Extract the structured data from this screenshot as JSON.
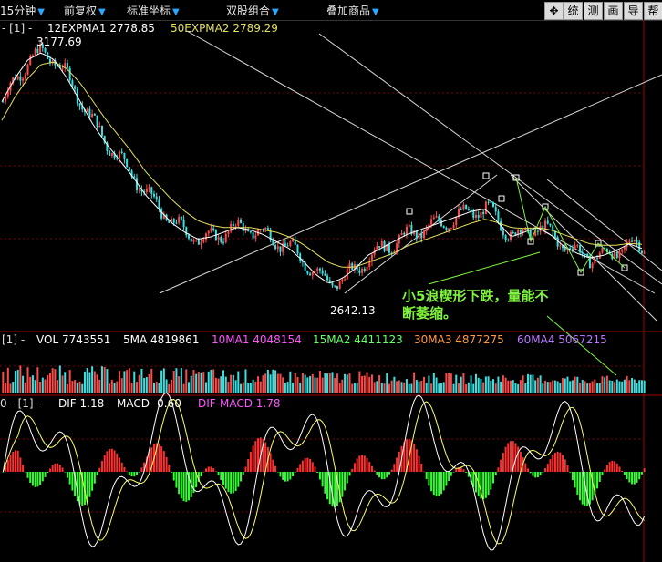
{
  "toolbar": {
    "period": "15分钟",
    "adjust": "前复权",
    "coord": "标准坐标",
    "dual": "双股组合",
    "overlay": "叠加商品",
    "buttons": [
      "统",
      "测",
      "画",
      "导",
      "帮"
    ]
  },
  "panels": {
    "price": {
      "marker": "- [1] -",
      "ema1": "12EXPMA1 2778.85",
      "ema2": "50EXPMA2 2789.29",
      "high_label": "3177.69",
      "low_label": "2642.13"
    },
    "volume": {
      "marker": "[1] -",
      "vol": "VOL 7743551",
      "ma": [
        "5MA 4819861",
        "10MA1 4048154",
        "15MA2 4411123",
        "30MA3 4877275",
        "60MA4 5067215"
      ]
    },
    "macd": {
      "marker": "0 - [1] -",
      "dif": "DIF 1.18",
      "macd": "MACD -0.60",
      "difmacd": "DIF-MACD 1.78"
    }
  },
  "annotation": {
    "line1": "小5浪楔形下跌，量能不",
    "line2": "断萎缩。"
  },
  "colors": {
    "up": "#ff4a4a",
    "down": "#3ce0e0",
    "ema1": "#ffffff",
    "ema2": "#e6e05a",
    "grid": "#7a0000",
    "ma5": "#ffffff",
    "ma10": "#ff55ff",
    "ma15": "#66ff66",
    "ma30": "#ff9944",
    "ma60": "#bb77ff",
    "macd_pos": "#ff3030",
    "macd_neg": "#33ff33",
    "dif": "#ffffff",
    "dea": "#ffff66",
    "annotation": "#7ef53c",
    "trend": "#d8d8d8"
  },
  "chart_data": {
    "type": "line",
    "title": "",
    "xlabel": "",
    "ylabel": "",
    "ylim": [
      2600,
      3200
    ],
    "series": [
      {
        "name": "12EXPMA1",
        "values": [
          3060,
          3110,
          3150,
          3165,
          3150,
          3110,
          3060,
          3010,
          2970,
          2935,
          2900,
          2860,
          2830,
          2800,
          2780,
          2765,
          2770,
          2780,
          2790,
          2785,
          2775,
          2760,
          2745,
          2720,
          2690,
          2670,
          2680,
          2700,
          2730,
          2745,
          2760,
          2775,
          2785,
          2795,
          2805,
          2815,
          2825,
          2830,
          2800,
          2770,
          2780,
          2790,
          2775,
          2750,
          2735,
          2725,
          2730,
          2740,
          2755,
          2745
        ]
      },
      {
        "name": "50EXPMA2",
        "values": [
          3020,
          3070,
          3110,
          3140,
          3145,
          3130,
          3100,
          3060,
          3020,
          2985,
          2950,
          2910,
          2880,
          2850,
          2825,
          2805,
          2795,
          2790,
          2790,
          2790,
          2785,
          2780,
          2770,
          2755,
          2735,
          2715,
          2705,
          2705,
          2715,
          2725,
          2735,
          2750,
          2760,
          2770,
          2780,
          2790,
          2800,
          2808,
          2800,
          2790,
          2788,
          2790,
          2785,
          2775,
          2765,
          2755,
          2752,
          2752,
          2756,
          2754
        ]
      }
    ],
    "x": [],
    "extremes": {
      "high": 3177.69,
      "low": 2642.13
    }
  }
}
